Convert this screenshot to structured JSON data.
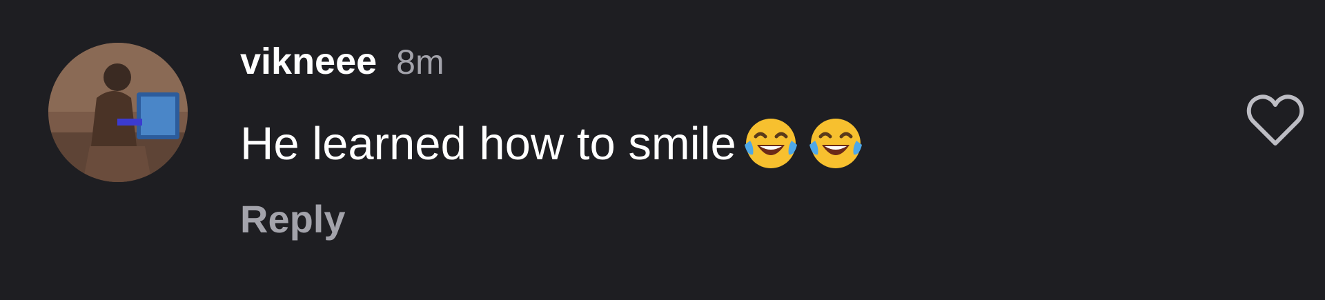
{
  "comment": {
    "username": "vikneee",
    "time_ago": "8m",
    "text": "He learned how to smile",
    "emojis": [
      "face-with-tears-of-joy-icon",
      "face-with-tears-of-joy-icon"
    ],
    "reply_label": "Reply",
    "like_icon": "heart-outline-icon"
  },
  "colors": {
    "background": "#1e1e22",
    "primary_text": "#ffffff",
    "secondary_text": "#a3a3ab"
  }
}
